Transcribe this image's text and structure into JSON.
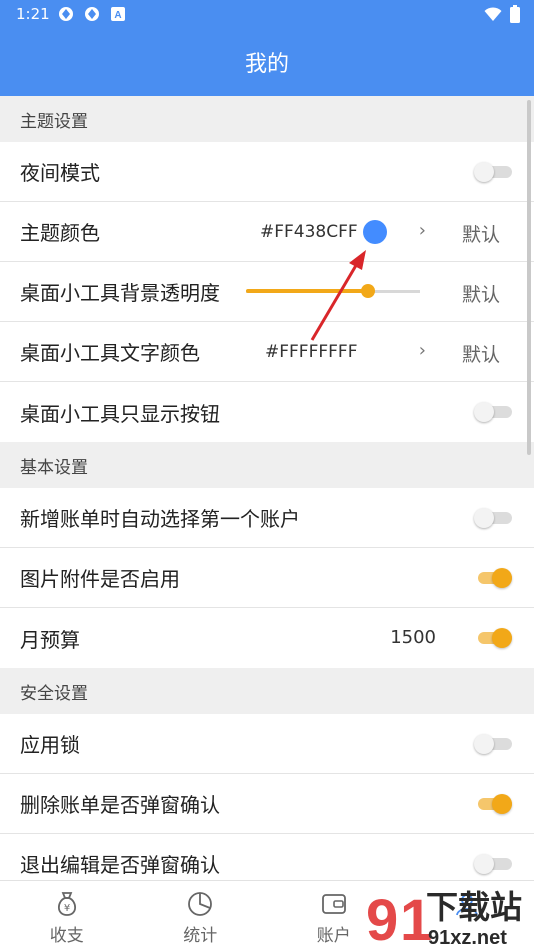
{
  "status_bar": {
    "time": "1:21",
    "left_icons": [
      "app-icon",
      "app-icon",
      "a-icon"
    ],
    "right_icons": [
      "wifi-icon",
      "battery-icon"
    ]
  },
  "app_bar": {
    "title": "我的"
  },
  "sections": {
    "theme": {
      "header": "主题设置",
      "night_mode": {
        "label": "夜间模式",
        "on": false
      },
      "theme_color": {
        "label": "主题颜色",
        "value": "#FF438CFF",
        "swatch": "#438cff",
        "default": "默认"
      },
      "widget_bg_opacity": {
        "label": "桌面小工具背景透明度",
        "level": 0.7,
        "default": "默认"
      },
      "widget_text_color": {
        "label": "桌面小工具文字颜色",
        "value": "#FFFFFFFF",
        "default": "默认"
      },
      "widget_buttons_only": {
        "label": "桌面小工具只显示按钮",
        "on": false
      }
    },
    "basic": {
      "header": "基本设置",
      "auto_select_account": {
        "label": "新增账单时自动选择第一个账户",
        "on": false
      },
      "image_attachments": {
        "label": "图片附件是否启用",
        "on": true
      },
      "monthly_budget": {
        "label": "月预算",
        "value": "1500",
        "on": true
      }
    },
    "security": {
      "header": "安全设置",
      "app_lock": {
        "label": "应用锁",
        "on": false
      },
      "delete_confirm": {
        "label": "删除账单是否弹窗确认",
        "on": true
      },
      "exit_edit_confirm": {
        "label": "退出编辑是否弹窗确认",
        "on": false
      }
    }
  },
  "bottom_nav": [
    {
      "label": "收支",
      "icon": "money-bag-icon"
    },
    {
      "label": "统计",
      "icon": "pie-chart-icon"
    },
    {
      "label": "账户",
      "icon": "wallet-icon"
    },
    {
      "label": "",
      "icon": "profile-icon"
    }
  ],
  "watermark": {
    "text": "下载站",
    "sub": "91xz.net"
  },
  "colors": {
    "primary": "#4a8ef1",
    "accent": "#f2a818",
    "annotation": "#d9262a"
  }
}
